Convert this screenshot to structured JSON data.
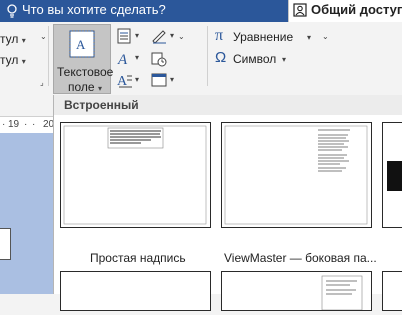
{
  "titlebar": {
    "tell_me": "Что вы хотите сделать?",
    "share_label": "Общий доступ"
  },
  "ribbon": {
    "left_items": [
      "тул",
      "тул"
    ],
    "textbox_label_line1": "Текстовое",
    "textbox_label_line2": "поле",
    "equation_label": "Уравнение",
    "symbol_label": "Символ",
    "pi_glyph": "π",
    "omega_glyph": "Ω"
  },
  "ruler": {
    "ticks": [
      "19",
      "20"
    ]
  },
  "gallery": {
    "header": "Встроенный",
    "items": [
      {
        "caption": "Простая надпись"
      },
      {
        "caption": "ViewMaster — боковая па..."
      }
    ]
  },
  "colors": {
    "titlebar": "#2b579a",
    "doc_background": "#aabfe2",
    "selected_button": "#c5c5c5"
  }
}
